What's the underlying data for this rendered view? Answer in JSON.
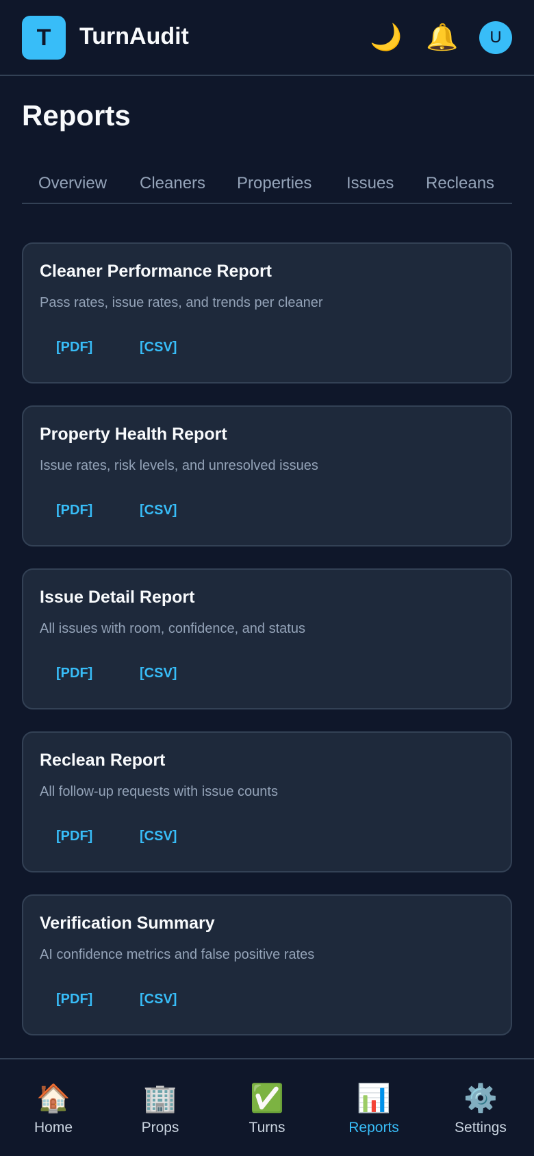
{
  "app": {
    "logo_letter": "T",
    "name": "TurnAudit"
  },
  "header": {
    "theme_icon": "🌙",
    "bell_icon": "🔔",
    "avatar_letter": "U"
  },
  "page": {
    "title": "Reports"
  },
  "tabs": [
    {
      "label": "Overview"
    },
    {
      "label": "Cleaners"
    },
    {
      "label": "Properties"
    },
    {
      "label": "Issues"
    },
    {
      "label": "Recleans"
    }
  ],
  "reports": [
    {
      "title": "Cleaner Performance Report",
      "description": "Pass rates, issue rates, and trends per cleaner",
      "pdf_label": "[PDF]",
      "csv_label": "[CSV]"
    },
    {
      "title": "Property Health Report",
      "description": "Issue rates, risk levels, and unresolved issues",
      "pdf_label": "[PDF]",
      "csv_label": "[CSV]"
    },
    {
      "title": "Issue Detail Report",
      "description": "All issues with room, confidence, and status",
      "pdf_label": "[PDF]",
      "csv_label": "[CSV]"
    },
    {
      "title": "Reclean Report",
      "description": "All follow-up requests with issue counts",
      "pdf_label": "[PDF]",
      "csv_label": "[CSV]"
    },
    {
      "title": "Verification Summary",
      "description": "AI confidence metrics and false positive rates",
      "pdf_label": "[PDF]",
      "csv_label": "[CSV]"
    }
  ],
  "nav": [
    {
      "icon": "🏠",
      "label": "Home"
    },
    {
      "icon": "🏢",
      "label": "Props"
    },
    {
      "icon": "✅",
      "label": "Turns"
    },
    {
      "icon": "📊",
      "label": "Reports"
    },
    {
      "icon": "⚙️",
      "label": "Settings"
    }
  ],
  "colors": {
    "background": "#0f172a",
    "card": "#1e293b",
    "accent": "#38bdf8",
    "border": "#334155",
    "muted": "#94a3b8"
  }
}
